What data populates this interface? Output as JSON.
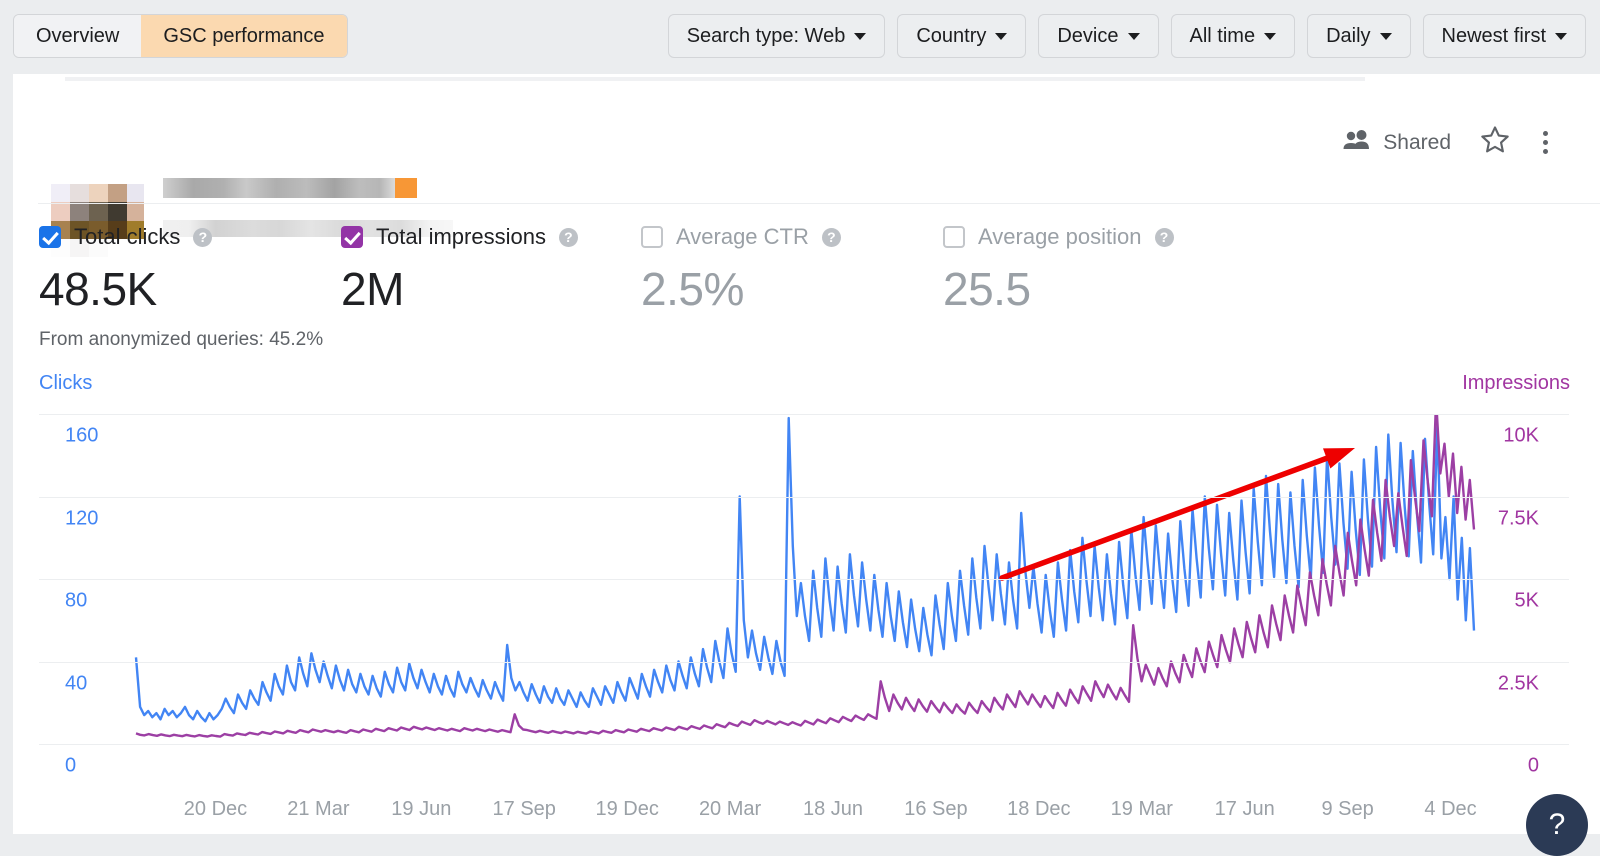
{
  "toolbar": {
    "tabs": [
      {
        "label": "Overview",
        "active": false
      },
      {
        "label": "GSC performance",
        "active": true
      }
    ],
    "filters": [
      {
        "label": "Search type: Web"
      },
      {
        "label": "Country"
      },
      {
        "label": "Device"
      },
      {
        "label": "All time"
      },
      {
        "label": "Daily"
      },
      {
        "label": "Newest first"
      }
    ]
  },
  "property_header": {
    "shared_label": "Shared",
    "thumbnail_state": "blurred",
    "title_state": "blurred",
    "subtitle_state": "blurred",
    "accent_color": "#f79736"
  },
  "metrics": [
    {
      "label": "Total clicks",
      "value": "48.5K",
      "checked": true,
      "color": "#1a73e8"
    },
    {
      "label": "Total impressions",
      "value": "2M",
      "checked": true,
      "color": "#9334a6"
    },
    {
      "label": "Average CTR",
      "value": "2.5%",
      "checked": false,
      "color": "#9aa0a6"
    },
    {
      "label": "Average position",
      "value": "25.5",
      "checked": false,
      "color": "#9aa0a6"
    }
  ],
  "anonymized_note": "From anonymized queries: 45.2%",
  "help_fab_label": "?",
  "chart_data": {
    "type": "line",
    "title": "",
    "xlabel": "",
    "grid": true,
    "legend": "axis-titles",
    "left_axis": {
      "label": "Clicks",
      "color": "#4285f4",
      "ticks": [
        "0",
        "40",
        "80",
        "120",
        "160"
      ],
      "ylim": [
        0,
        160
      ]
    },
    "right_axis": {
      "label": "Impressions",
      "color": "#a136a1",
      "ticks": [
        "0",
        "2.5K",
        "5K",
        "7.5K",
        "10K"
      ],
      "ylim": [
        0,
        10000
      ]
    },
    "tick_labels": [
      "20 Dec",
      "21 Mar",
      "19 Jun",
      "17 Sep",
      "19 Dec",
      "20 Mar",
      "18 Jun",
      "16 Sep",
      "18 Dec",
      "19 Mar",
      "17 Jun",
      "9 Sep",
      "4 Dec"
    ],
    "series": [
      {
        "name": "Clicks",
        "color": "#4285f4",
        "axis": "left",
        "values": [
          42,
          18,
          14,
          16,
          13,
          15,
          12,
          17,
          14,
          16,
          13,
          15,
          18,
          14,
          12,
          16,
          13,
          11,
          15,
          12,
          14,
          17,
          22,
          18,
          15,
          24,
          20,
          17,
          26,
          22,
          19,
          30,
          25,
          21,
          34,
          28,
          24,
          38,
          30,
          26,
          42,
          34,
          28,
          44,
          36,
          30,
          40,
          33,
          27,
          38,
          31,
          26,
          36,
          29,
          25,
          34,
          28,
          24,
          33,
          27,
          23,
          35,
          29,
          25,
          37,
          30,
          26,
          39,
          32,
          27,
          36,
          30,
          25,
          34,
          28,
          24,
          33,
          27,
          23,
          35,
          29,
          25,
          32,
          27,
          23,
          31,
          26,
          22,
          30,
          25,
          21,
          48,
          32,
          26,
          30,
          25,
          21,
          29,
          24,
          20,
          28,
          23,
          20,
          27,
          22,
          19,
          26,
          22,
          18,
          25,
          21,
          18,
          27,
          23,
          19,
          28,
          24,
          20,
          30,
          25,
          21,
          32,
          27,
          22,
          34,
          28,
          23,
          36,
          30,
          25,
          38,
          31,
          26,
          40,
          33,
          27,
          42,
          34,
          28,
          46,
          37,
          30,
          50,
          40,
          32,
          56,
          44,
          35,
          120,
          60,
          42,
          55,
          44,
          36,
          52,
          42,
          34,
          50,
          40,
          33,
          158,
          96,
          62,
          78,
          62,
          50,
          84,
          66,
          52,
          90,
          70,
          55,
          86,
          68,
          54,
          92,
          72,
          57,
          88,
          70,
          55,
          82,
          65,
          52,
          78,
          62,
          50,
          74,
          59,
          47,
          70,
          56,
          45,
          66,
          53,
          43,
          72,
          58,
          46,
          78,
          62,
          50,
          84,
          67,
          53,
          90,
          71,
          56,
          96,
          76,
          60,
          92,
          73,
          58,
          88,
          70,
          56,
          112,
          84,
          66,
          86,
          68,
          54,
          82,
          65,
          52,
          88,
          70,
          55,
          94,
          74,
          59,
          100,
          79,
          62,
          96,
          76,
          60,
          92,
          73,
          58,
          98,
          77,
          61,
          104,
          82,
          65,
          110,
          87,
          68,
          106,
          84,
          66,
          102,
          81,
          64,
          108,
          85,
          67,
          114,
          90,
          71,
          120,
          95,
          75,
          116,
          92,
          72,
          112,
          89,
          70,
          118,
          93,
          73,
          124,
          98,
          77,
          130,
          103,
          81,
          126,
          99,
          78,
          122,
          96,
          76,
          128,
          101,
          80,
          134,
          106,
          83,
          140,
          110,
          87,
          136,
          107,
          85,
          132,
          104,
          82,
          138,
          109,
          86,
          144,
          114,
          90,
          150,
          118,
          93,
          146,
          115,
          91,
          142,
          112,
          88,
          148,
          117,
          92,
          154,
          90,
          110,
          80,
          120,
          70,
          100,
          60,
          95,
          55
        ]
      },
      {
        "name": "Impressions",
        "color": "#9c3fa4",
        "axis": "right",
        "values": [
          320,
          280,
          260,
          300,
          270,
          250,
          290,
          260,
          240,
          280,
          255,
          235,
          275,
          250,
          230,
          270,
          245,
          228,
          265,
          242,
          225,
          300,
          275,
          255,
          320,
          295,
          272,
          340,
          312,
          288,
          360,
          330,
          305,
          380,
          350,
          322,
          400,
          368,
          340,
          420,
          386,
          356,
          440,
          405,
          374,
          420,
          387,
          357,
          400,
          368,
          340,
          420,
          386,
          356,
          440,
          405,
          374,
          460,
          423,
          391,
          480,
          442,
          408,
          500,
          460,
          425,
          520,
          478,
          442,
          500,
          460,
          425,
          480,
          442,
          408,
          460,
          423,
          391,
          480,
          442,
          408,
          460,
          423,
          391,
          440,
          405,
          374,
          420,
          387,
          357,
          900,
          560,
          440,
          420,
          387,
          357,
          400,
          368,
          340,
          390,
          359,
          331,
          380,
          350,
          322,
          370,
          340,
          314,
          380,
          350,
          322,
          400,
          368,
          340,
          420,
          386,
          356,
          440,
          405,
          374,
          460,
          423,
          391,
          480,
          442,
          408,
          500,
          460,
          425,
          520,
          478,
          442,
          540,
          497,
          459,
          560,
          515,
          476,
          600,
          552,
          510,
          640,
          589,
          544,
          680,
          626,
          578,
          720,
          662,
          612,
          700,
          644,
          595,
          680,
          626,
          578,
          660,
          607,
          561,
          700,
          644,
          595,
          740,
          681,
          629,
          780,
          718,
          663,
          820,
          754,
          697,
          860,
          791,
          731,
          900,
          828,
          765,
          1900,
          1400,
          1000,
          1500,
          1250,
          1050,
          1400,
          1180,
          1000,
          1350,
          1150,
          980,
          1300,
          1120,
          960,
          1250,
          1080,
          940,
          1200,
          1040,
          920,
          1250,
          1080,
          940,
          1300,
          1130,
          980,
          1400,
          1210,
          1050,
          1500,
          1300,
          1120,
          1600,
          1390,
          1200,
          1500,
          1300,
          1120,
          1450,
          1260,
          1090,
          1550,
          1340,
          1160,
          1650,
          1430,
          1240,
          1750,
          1520,
          1310,
          1900,
          1640,
          1420,
          1800,
          1560,
          1350,
          1700,
          1480,
          1280,
          3600,
          2600,
          1900,
          2400,
          2100,
          1800,
          2300,
          2000,
          1750,
          2500,
          2150,
          1870,
          2700,
          2340,
          2030,
          2900,
          2510,
          2180,
          3100,
          2690,
          2330,
          3300,
          2860,
          2480,
          3500,
          3030,
          2630,
          3700,
          3210,
          2780,
          3900,
          3380,
          2930,
          4200,
          3640,
          3150,
          4500,
          3900,
          3380,
          4800,
          4160,
          3600,
          5200,
          4500,
          3900,
          5600,
          4850,
          4200,
          6000,
          5200,
          4500,
          6400,
          5550,
          4810,
          6800,
          5900,
          5100,
          7400,
          6400,
          5550,
          8000,
          6900,
          6000,
          7600,
          6600,
          5700,
          8600,
          7450,
          6450,
          9200,
          7970,
          6900,
          10450,
          8200,
          9100,
          7500,
          8800,
          7000,
          8400,
          6800,
          8000,
          6500
        ]
      }
    ],
    "annotation": {
      "type": "arrow",
      "color": "#ee0000",
      "from": [
        1002,
        578
      ],
      "to": [
        1355,
        448
      ],
      "meaning": "upward growth trend"
    }
  }
}
